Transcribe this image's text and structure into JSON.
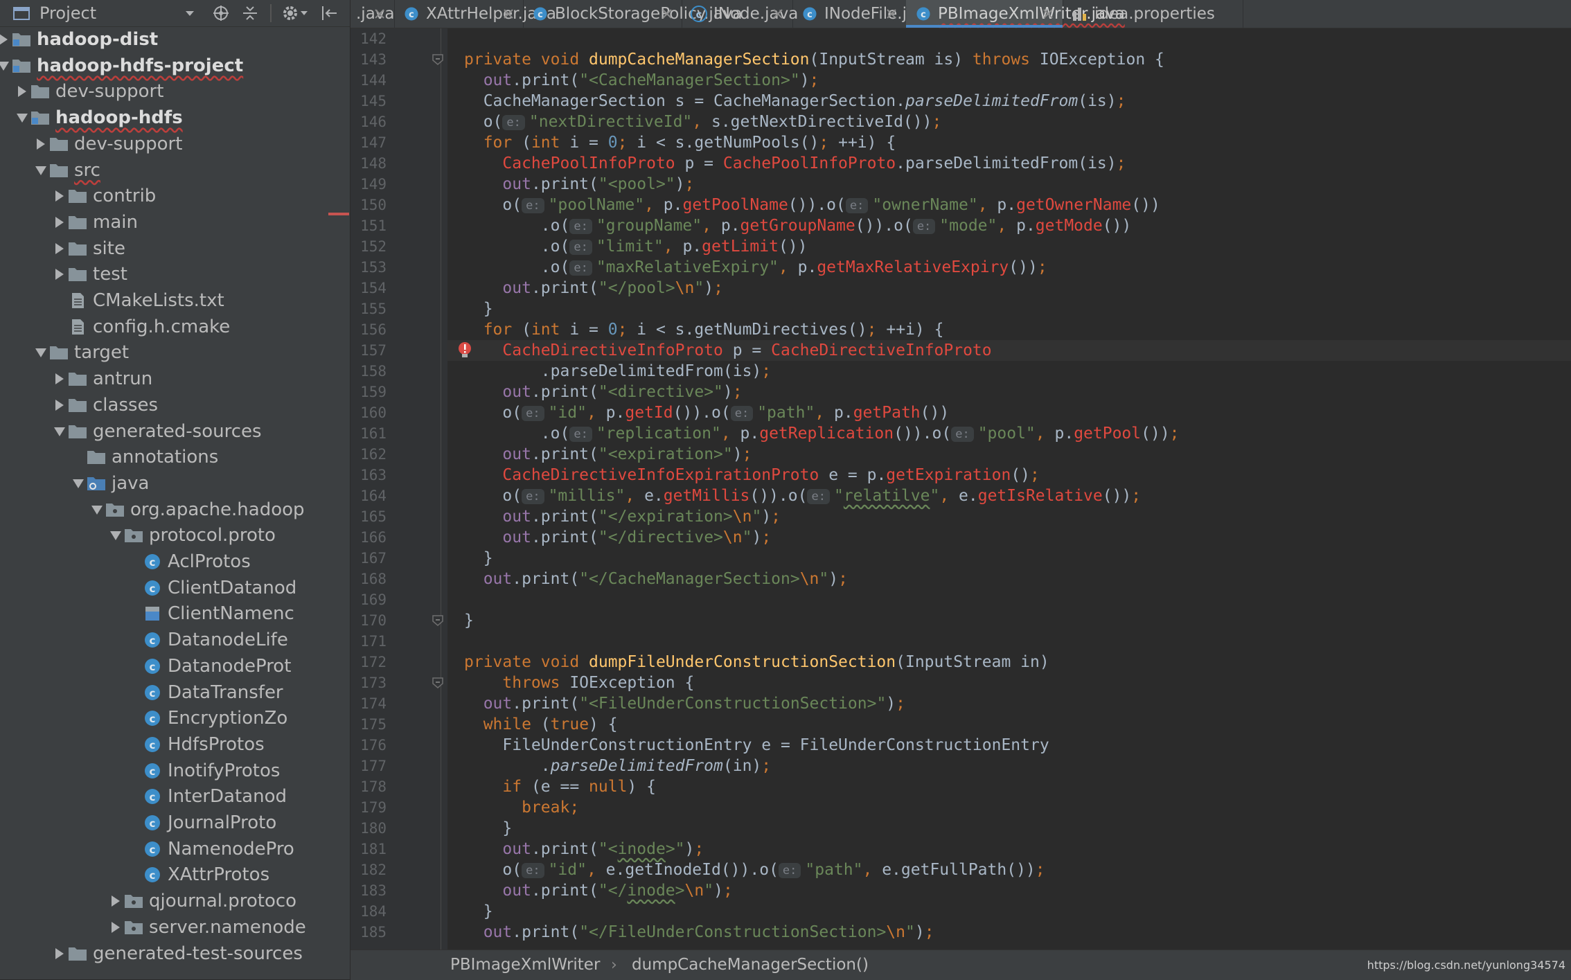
{
  "project_panel": {
    "title": "Project",
    "tree": [
      {
        "label": "hadoop-dist",
        "icon": "module-folder-icon",
        "arrow": "collapsed",
        "depth": 0,
        "bold": true
      },
      {
        "label": "hadoop-hdfs-project",
        "icon": "module-folder-icon",
        "arrow": "expanded",
        "depth": 0,
        "bold": true,
        "squiggle": true
      },
      {
        "label": "dev-support",
        "icon": "folder-icon",
        "arrow": "collapsed",
        "depth": 1
      },
      {
        "label": "hadoop-hdfs",
        "icon": "module-folder-icon",
        "arrow": "expanded",
        "depth": 1,
        "bold": true,
        "squiggle": true
      },
      {
        "label": "dev-support",
        "icon": "folder-icon",
        "arrow": "collapsed",
        "depth": 2
      },
      {
        "label": "src",
        "icon": "folder-icon",
        "arrow": "expanded",
        "depth": 2,
        "squiggle": true
      },
      {
        "label": "contrib",
        "icon": "folder-icon",
        "arrow": "collapsed",
        "depth": 3
      },
      {
        "label": "main",
        "icon": "folder-icon",
        "arrow": "collapsed",
        "depth": 3
      },
      {
        "label": "site",
        "icon": "folder-icon",
        "arrow": "collapsed",
        "depth": 3
      },
      {
        "label": "test",
        "icon": "folder-icon",
        "arrow": "collapsed",
        "depth": 3
      },
      {
        "label": "CMakeLists.txt",
        "icon": "text-file-icon",
        "arrow": "none",
        "depth": 3
      },
      {
        "label": "config.h.cmake",
        "icon": "text-file-icon",
        "arrow": "none",
        "depth": 3
      },
      {
        "label": "target",
        "icon": "folder-icon",
        "arrow": "expanded",
        "depth": 2
      },
      {
        "label": "antrun",
        "icon": "folder-icon",
        "arrow": "collapsed",
        "depth": 3
      },
      {
        "label": "classes",
        "icon": "folder-icon",
        "arrow": "collapsed",
        "depth": 3
      },
      {
        "label": "generated-sources",
        "icon": "folder-icon",
        "arrow": "expanded",
        "depth": 3
      },
      {
        "label": "annotations",
        "icon": "folder-icon",
        "arrow": "none",
        "depth": 4
      },
      {
        "label": "java",
        "icon": "source-root-icon",
        "arrow": "expanded",
        "depth": 4
      },
      {
        "label": "org.apache.hadoop",
        "icon": "package-icon",
        "arrow": "expanded",
        "depth": 5
      },
      {
        "label": "protocol.proto",
        "icon": "package-icon",
        "arrow": "expanded",
        "depth": 6
      },
      {
        "label": "AclProtos",
        "icon": "class-icon",
        "arrow": "none",
        "depth": 7
      },
      {
        "label": "ClientDatanod",
        "icon": "class-icon",
        "arrow": "none",
        "depth": 7
      },
      {
        "label": "ClientNamenc",
        "icon": "class-file-icon",
        "arrow": "none",
        "depth": 7
      },
      {
        "label": "DatanodeLife",
        "icon": "class-icon",
        "arrow": "none",
        "depth": 7
      },
      {
        "label": "DatanodeProt",
        "icon": "class-icon",
        "arrow": "none",
        "depth": 7
      },
      {
        "label": "DataTransfer",
        "icon": "class-icon",
        "arrow": "none",
        "depth": 7
      },
      {
        "label": "EncryptionZo",
        "icon": "class-icon",
        "arrow": "none",
        "depth": 7
      },
      {
        "label": "HdfsProtos",
        "icon": "class-icon",
        "arrow": "none",
        "depth": 7
      },
      {
        "label": "InotifyProtos",
        "icon": "class-icon",
        "arrow": "none",
        "depth": 7
      },
      {
        "label": "InterDatanod",
        "icon": "class-icon",
        "arrow": "none",
        "depth": 7
      },
      {
        "label": "JournalProto",
        "icon": "class-icon",
        "arrow": "none",
        "depth": 7
      },
      {
        "label": "NamenodePro",
        "icon": "class-icon",
        "arrow": "none",
        "depth": 7
      },
      {
        "label": "XAttrProtos",
        "icon": "class-icon",
        "arrow": "none",
        "depth": 7
      },
      {
        "label": "qjournal.protoco",
        "icon": "package-icon",
        "arrow": "collapsed",
        "depth": 6
      },
      {
        "label": "server.namenode",
        "icon": "package-icon",
        "arrow": "collapsed",
        "depth": 6
      },
      {
        "label": "generated-test-sources",
        "icon": "folder-icon",
        "arrow": "collapsed",
        "depth": 3
      }
    ]
  },
  "tabs": [
    {
      "label": ".java",
      "icon": "",
      "active": false
    },
    {
      "label": "XAttrHelper.java",
      "icon": "class-icon",
      "active": false
    },
    {
      "label": "BlockStoragePolicy.java",
      "icon": "class-icon",
      "active": false
    },
    {
      "label": "INode.java",
      "icon": "abstract-class-icon",
      "active": false
    },
    {
      "label": "INodeFile.java",
      "icon": "class-icon",
      "active": false
    },
    {
      "label": "PBImageXmlWriter.java",
      "icon": "class-icon",
      "active": true
    },
    {
      "label": "idea.properties",
      "icon": "properties-file-icon",
      "active": false
    }
  ],
  "editor": {
    "first_line": 142,
    "last_line": 185,
    "code_lines": [
      "",
      "<span class=\"kw\">private void </span><span class=\"fn\">dumpCacheManagerSection</span>(InputStream is) <span class=\"kw\">throws </span>IOException {",
      "  <span class=\"fld\">out</span>.print(<span class=\"str\">\"&lt;CacheManagerSection&gt;\"</span>)<span class=\"kw\">;</span>",
      "  CacheManagerSection s = CacheManagerSection.<span class=\"it\">parseDelimitedFrom</span>(is)<span class=\"kw\">;</span>",
      "  o(<span class=\"hint\">e:</span><span class=\"str\">\"nextDirectiveId\"</span><span class=\"kw\">, </span>s.getNextDirectiveId())<span class=\"kw\">;</span>",
      "  <span class=\"kw\">for </span>(<span class=\"kw\">int </span>i = <span class=\"num\">0</span><span class=\"kw\">; </span>i &lt; s.getNumPools()<span class=\"kw\">; </span>++i) {",
      "    <span class=\"err\">CachePoolInfoProto</span> p = <span class=\"err\">CachePoolInfoProto</span>.parseDelimitedFrom(is)<span class=\"kw\">;</span>",
      "    <span class=\"fld\">out</span>.print(<span class=\"str\">\"&lt;pool&gt;\"</span>)<span class=\"kw\">;</span>",
      "    o(<span class=\"hint\">e:</span><span class=\"str\">\"poolName\"</span><span class=\"kw\">, </span>p.<span class=\"err\">getPoolName</span>()).o(<span class=\"hint\">e:</span><span class=\"str\">\"ownerName\"</span><span class=\"kw\">, </span>p.<span class=\"err\">getOwnerName</span>())",
      "        .o(<span class=\"hint\">e:</span><span class=\"str\">\"groupName\"</span><span class=\"kw\">, </span>p.<span class=\"err\">getGroupName</span>()).o(<span class=\"hint\">e:</span><span class=\"str\">\"mode\"</span><span class=\"kw\">, </span>p.<span class=\"err\">getMode</span>())",
      "        .o(<span class=\"hint\">e:</span><span class=\"str\">\"limit\"</span><span class=\"kw\">, </span>p.<span class=\"err\">getLimit</span>())",
      "        .o(<span class=\"hint\">e:</span><span class=\"str\">\"maxRelativeExpiry\"</span><span class=\"kw\">, </span>p.<span class=\"err\">getMaxRelativeExpiry</span>())<span class=\"kw\">;</span>",
      "    <span class=\"fld\">out</span>.print(<span class=\"str\">\"&lt;/pool&gt;<span class=\"kw\">\\n</span>\"</span>)<span class=\"kw\">;</span>",
      "  }",
      "  <span class=\"kw\">for </span>(<span class=\"kw\">int </span>i = <span class=\"num\">0</span><span class=\"kw\">; </span>i &lt; s.getNumDirectives()<span class=\"kw\">; </span>++i) {",
      "    <span class=\"err\">CacheDirectiveInfoProto</span> p = <span class=\"err\">CacheDirectiveInfoProto</span>",
      "        .parseDelimitedFrom(is)<span class=\"kw\">;</span>",
      "    <span class=\"fld\">out</span>.print(<span class=\"str\">\"&lt;directive&gt;\"</span>)<span class=\"kw\">;</span>",
      "    o(<span class=\"hint\">e:</span><span class=\"str\">\"id\"</span><span class=\"kw\">, </span>p.<span class=\"err\">getId</span>()).o(<span class=\"hint\">e:</span><span class=\"str\">\"path\"</span><span class=\"kw\">, </span>p.<span class=\"err\">getPath</span>())",
      "        .o(<span class=\"hint\">e:</span><span class=\"str\">\"replication\"</span><span class=\"kw\">, </span>p.<span class=\"err\">getReplication</span>()).o(<span class=\"hint\">e:</span><span class=\"str\">\"pool\"</span><span class=\"kw\">, </span>p.<span class=\"err\">getPool</span>())<span class=\"kw\">;</span>",
      "    <span class=\"fld\">out</span>.print(<span class=\"str\">\"&lt;expiration&gt;\"</span>)<span class=\"kw\">;</span>",
      "    <span class=\"err\">CacheDirectiveInfoExpirationProto</span> e = p.<span class=\"err\">getExpiration</span>()<span class=\"kw\">;</span>",
      "    o(<span class=\"hint\">e:</span><span class=\"str\">\"millis\"</span><span class=\"kw\">, </span>e.<span class=\"err\">getMillis</span>()).o(<span class=\"hint\">e:</span><span class=\"str\">\"<span class=\"typo\">relatilve</span>\"</span><span class=\"kw\">, </span>e.<span class=\"err\">getIsRelative</span>())<span class=\"kw\">;</span>",
      "    <span class=\"fld\">out</span>.print(<span class=\"str\">\"&lt;/expiration&gt;<span class=\"kw\">\\n</span>\"</span>)<span class=\"kw\">;</span>",
      "    <span class=\"fld\">out</span>.print(<span class=\"str\">\"&lt;/directive&gt;<span class=\"kw\">\\n</span>\"</span>)<span class=\"kw\">;</span>",
      "  }",
      "  <span class=\"fld\">out</span>.print(<span class=\"str\">\"&lt;/CacheManagerSection&gt;<span class=\"kw\">\\n</span>\"</span>)<span class=\"kw\">;</span>",
      "",
      "}",
      "",
      "<span class=\"kw\">private void </span><span class=\"fn\">dumpFileUnderConstructionSection</span>(InputStream in)",
      "    <span class=\"kw\">throws </span>IOException {",
      "  <span class=\"fld\">out</span>.print(<span class=\"str\">\"&lt;FileUnderConstructionSection&gt;\"</span>)<span class=\"kw\">;</span>",
      "  <span class=\"kw\">while </span>(<span class=\"kw\">true</span>) {",
      "    FileUnderConstructionEntry e = FileUnderConstructionEntry",
      "        .<span class=\"it\">parseDelimitedFrom</span>(in)<span class=\"kw\">;</span>",
      "    <span class=\"kw\">if </span>(e == <span class=\"kw\">null</span>) {",
      "      <span class=\"kw\">break;</span>",
      "    }",
      "    <span class=\"fld\">out</span>.print(<span class=\"str\">\"&lt;<span class=\"typo\">inode</span>&gt;\"</span>)<span class=\"kw\">;</span>",
      "    o(<span class=\"hint\">e:</span><span class=\"str\">\"id\"</span><span class=\"kw\">, </span>e.getInodeId()).o(<span class=\"hint\">e:</span><span class=\"str\">\"path\"</span><span class=\"kw\">, </span>e.getFullPath())<span class=\"kw\">;</span>",
      "    <span class=\"fld\">out</span>.print(<span class=\"str\">\"&lt;/<span class=\"typo\">inode</span>&gt;<span class=\"kw\">\\n</span>\"</span>)<span class=\"kw\">;</span>",
      "  }",
      "  <span class=\"fld\">out</span>.print(<span class=\"str\">\"&lt;/FileUnderConstructionSection&gt;<span class=\"kw\">\\n</span>\"</span>)<span class=\"kw\">;</span>"
    ]
  },
  "breadcrumb": {
    "class_name": "PBImageXmlWriter",
    "separator": "›",
    "method_name": "dumpCacheManagerSection()"
  },
  "watermark": "https://blog.csdn.net/yunlong34574",
  "colors": {
    "accent": "#4a88c7",
    "keyword": "#cc7832",
    "string": "#6a8759",
    "error": "#e0493f"
  }
}
